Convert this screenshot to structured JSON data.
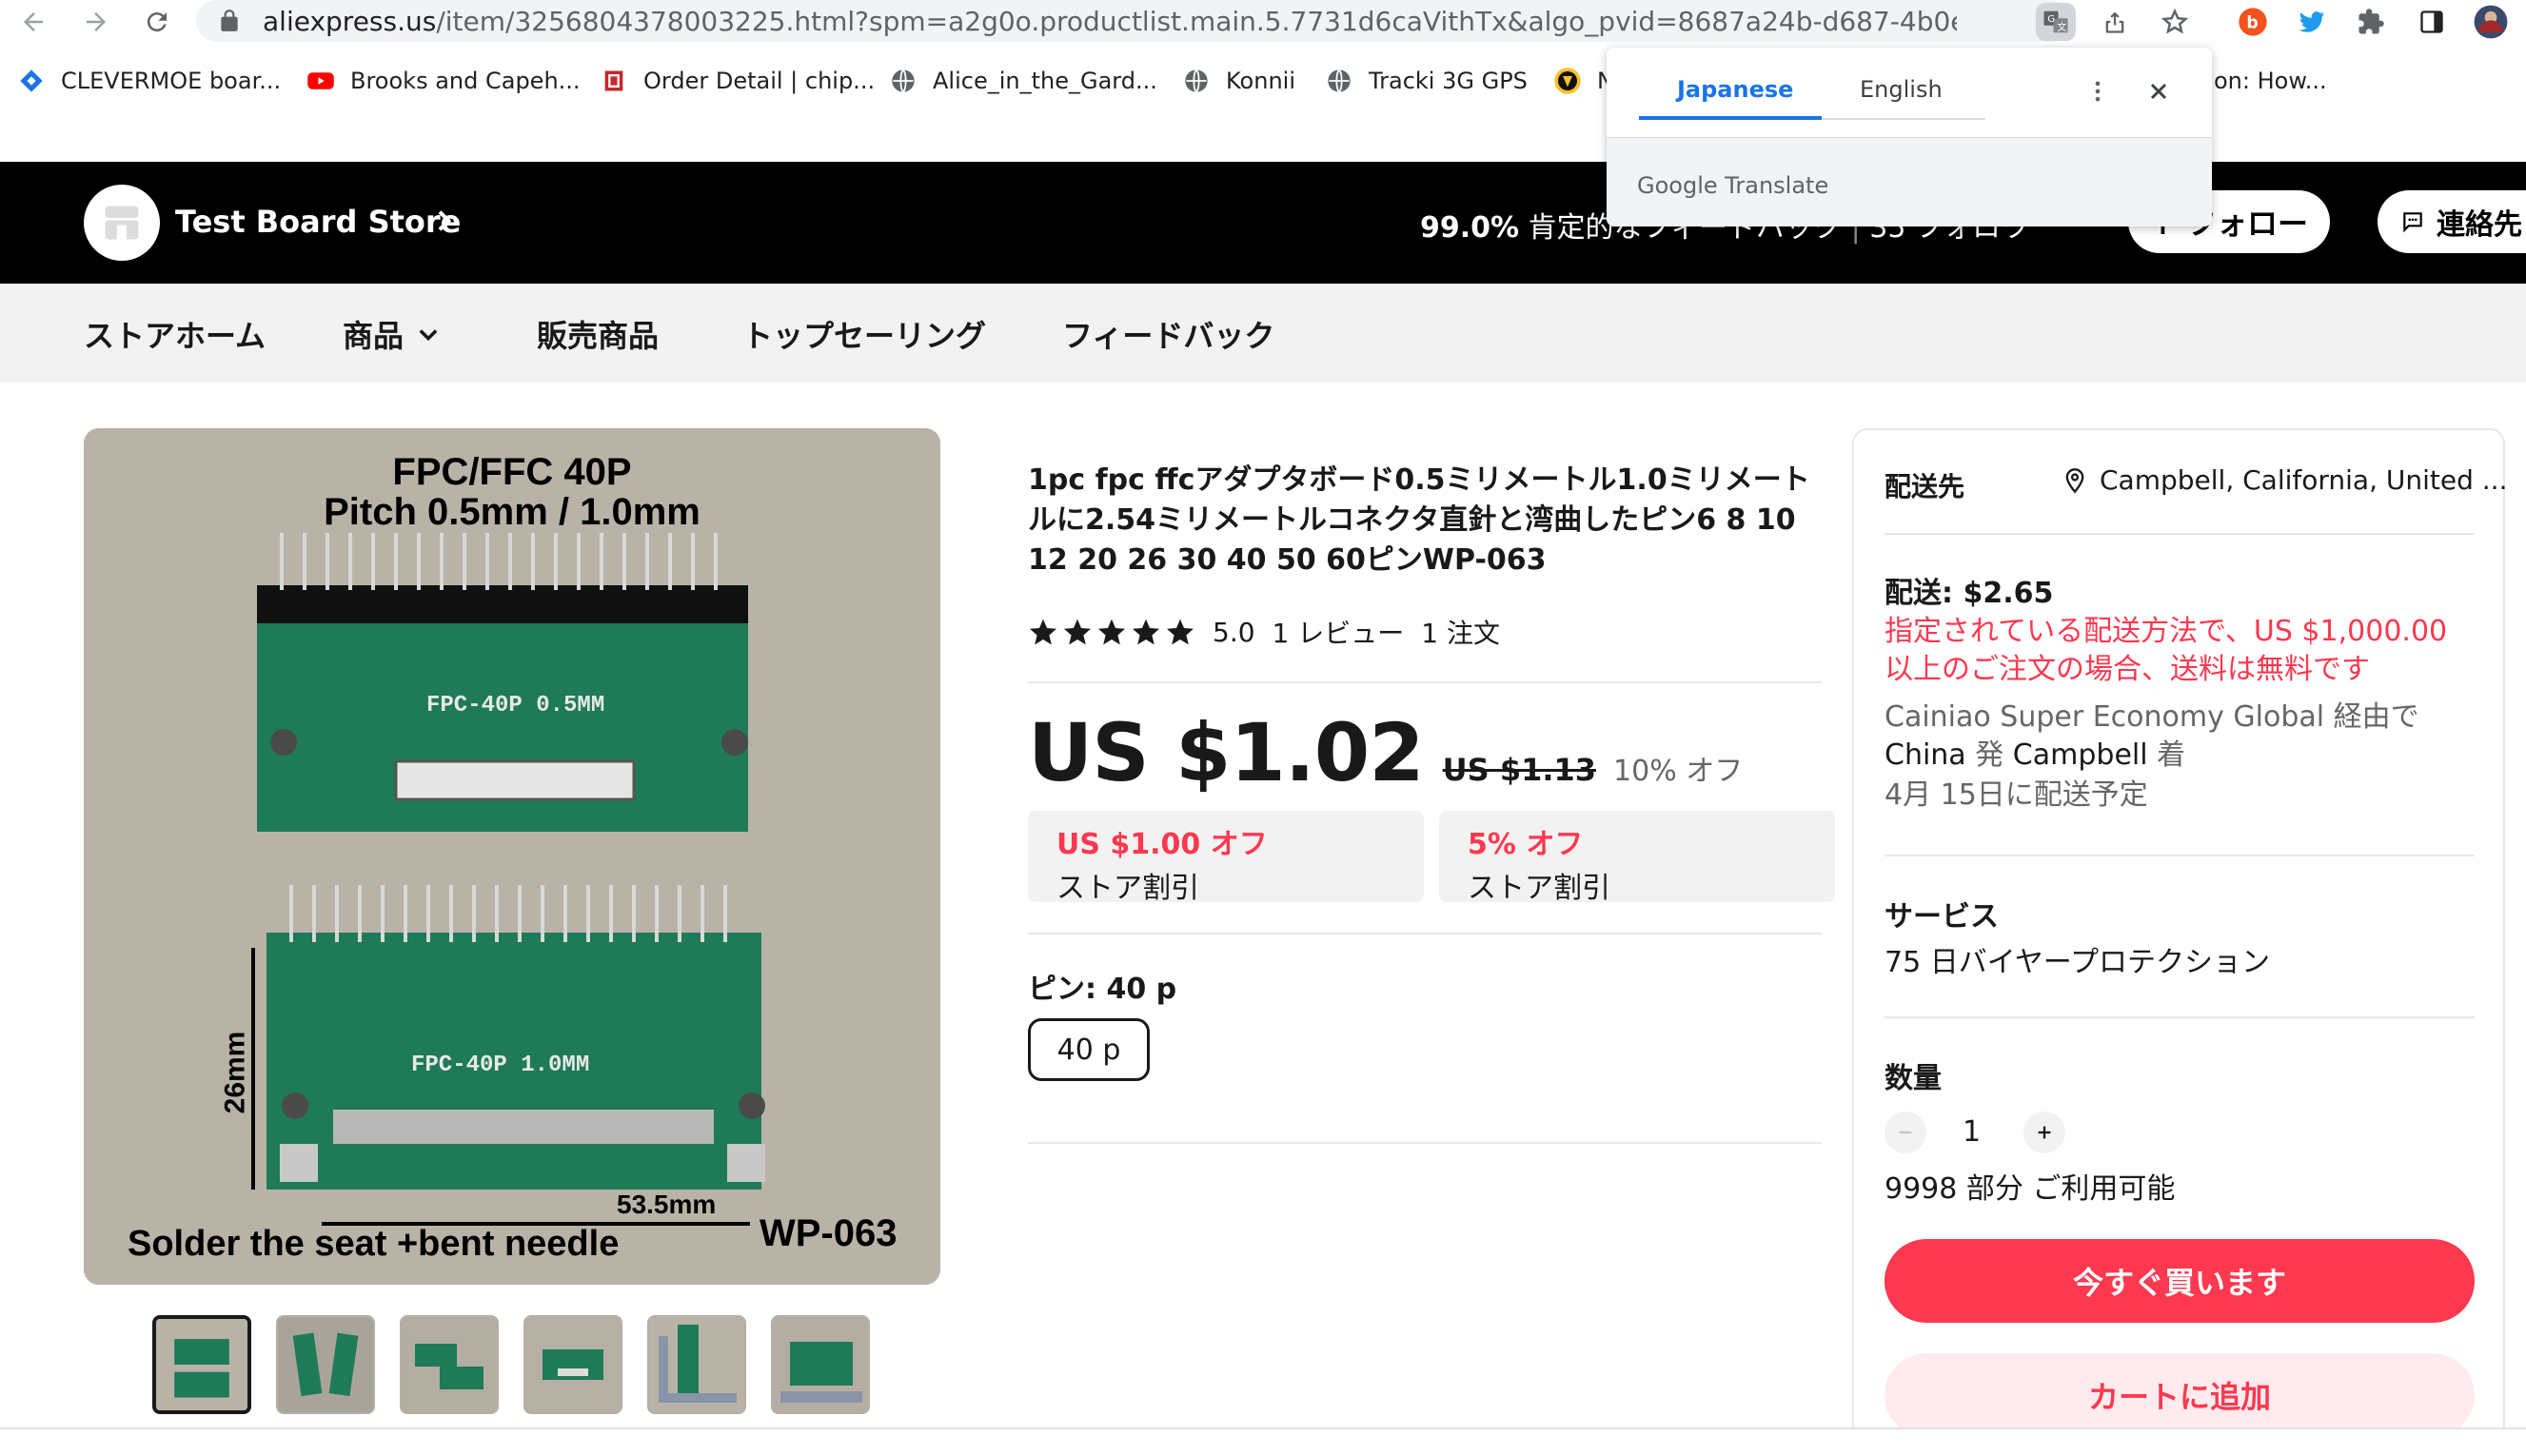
{
  "browser": {
    "url_host": "aliexpress.us",
    "url_path": "/item/3256804378003225.html?spm=a2g0o.productlist.main.5.7731d6caVithTx&algo_pvid=8687a24b-d687-4b0e-a1cb-4b...",
    "bookmarks": [
      {
        "label": "CLEVERMOE boar...",
        "icon": "diamond-icon",
        "color": "#1a73e8"
      },
      {
        "label": "Brooks and Capeh...",
        "icon": "youtube-icon",
        "color": "#ff0000"
      },
      {
        "label": "Order Detail | chip...",
        "icon": "chip-icon",
        "color": "#c62828"
      },
      {
        "label": "Alice_in_the_Gard...",
        "icon": "globe-icon",
        "color": "#5f6368"
      },
      {
        "label": "Konnii",
        "icon": "globe-icon",
        "color": "#5f6368"
      },
      {
        "label": "Tracki 3G GPS",
        "icon": "globe-icon",
        "color": "#5f6368"
      },
      {
        "label": "N",
        "icon": "shield-icon",
        "color": "#fbc02d"
      },
      {
        "label": "on: How...",
        "icon": "",
        "color": "#5f6368"
      }
    ]
  },
  "translate_popup": {
    "tab_source": "Japanese",
    "tab_target": "English",
    "footer": "Google Translate",
    "accent": "#1a73e8"
  },
  "store": {
    "name": "Test Board Store",
    "feedback_percent": "99.0%",
    "feedback_text": "肯定的なフィードバック",
    "followers": "35 フォロワ",
    "follow_label": "+ フォロー",
    "contact_label": "連絡先"
  },
  "store_nav": {
    "home": "ストアホーム",
    "products": "商品",
    "sale": "販売商品",
    "top_selling": "トップセーリング",
    "feedback": "フィードバック"
  },
  "image": {
    "title_line1": "FPC/FFC  40P",
    "title_line2": "Pitch 0.5mm / 1.0mm",
    "board1_label": "FPC-40P  0.5MM",
    "board2_label": "FPC-40P  1.0MM",
    "dim_height": "26mm",
    "dim_width": "53.5mm",
    "caption": "Solder the seat +bent needle",
    "model": "WP-063",
    "board_color": "#1f7a58"
  },
  "product": {
    "title": "1pc fpc ffcアダプタボード0.5ミリメートル1.0ミリメートルに2.54ミリメートルコネクタ直針と湾曲したピン6 8 10 12 20 26 30 40 50 60ピンWP-063",
    "rating": "5.0",
    "reviews": "1 レビュー",
    "orders": "1 注文",
    "price": "US $1.02",
    "old_price": "US $1.13",
    "discount": "10% オフ",
    "coupons": [
      {
        "top": "US $1.00 オフ",
        "bottom": "ストア割引"
      },
      {
        "top": "5% オフ",
        "bottom": "ストア割引"
      }
    ],
    "spec_label": "ピン: 40 p",
    "spec_value": "40 p"
  },
  "shipping": {
    "ship_to_label": "配送先",
    "location": "Campbell, California, United ...",
    "shipping_cost": "配送: $2.65",
    "free_notice": "指定されている配送方法で、US $1,000.00 以上のご注文の場合、送料は無料です",
    "carrier_prefix": "Cainiao Super Economy Global 経由で",
    "carrier_from": "China",
    "carrier_mid": "発",
    "carrier_to": "Campbell",
    "carrier_suffix": "着",
    "delivery": "4月 15日に配送予定",
    "service_label": "サービス",
    "service_value": "75 日バイヤープロテクション",
    "qty_label": "数量",
    "qty_value": "1",
    "stock": "9998 部分 ご利用可能",
    "buy_now": "今すぐ買います",
    "add_to_cart": "カートに追加",
    "accent": "#fd384f"
  }
}
